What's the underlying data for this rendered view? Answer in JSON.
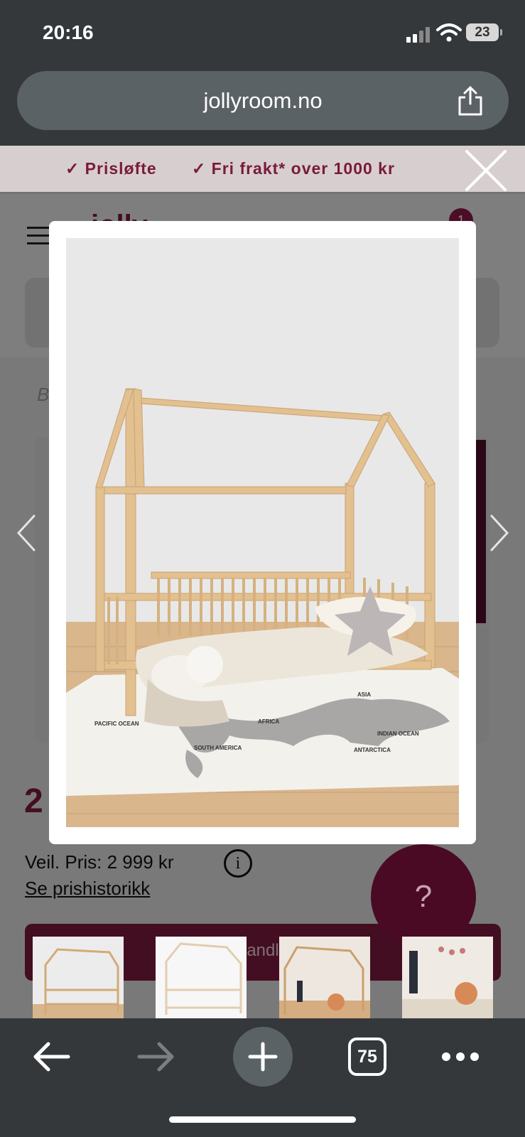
{
  "status_bar": {
    "time": "20:16",
    "battery": "23"
  },
  "browser": {
    "url": "jollyroom.no",
    "tab_count": "75"
  },
  "promo": {
    "item1": "Prisløfte",
    "item2": "Fri frakt* over 1000 kr"
  },
  "header": {
    "logo": "jolly",
    "cart_count": "1"
  },
  "breadcrumb": {
    "text": "B /"
  },
  "product": {
    "price_partial": "2",
    "veil_price": "Veil. Pris: 2 999 kr",
    "history_link": "Se prishistorikk",
    "cta_label": "andl"
  },
  "help": {
    "label": "?"
  },
  "map_labels": {
    "pacific": "PACIFIC OCEAN",
    "south_america": "SOUTH AMERICA",
    "africa": "AFRICA",
    "asia": "ASIA",
    "indian": "INDIAN OCEAN",
    "antarctica": "ANTARCTICA"
  },
  "colors": {
    "brand": "#7a1a3c",
    "brand_dark": "#4a0a24",
    "chrome": "#34383b"
  }
}
